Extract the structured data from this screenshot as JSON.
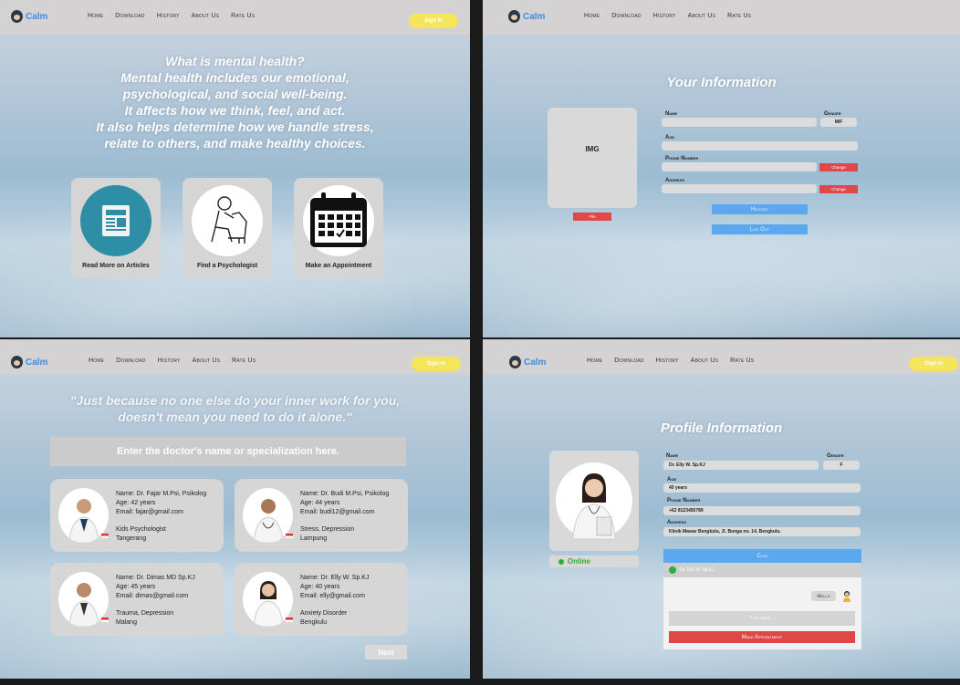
{
  "nav": {
    "brand": "Calm",
    "links": [
      "Home",
      "Download",
      "History",
      "About Us",
      "Rate Us"
    ],
    "signin": "Sign In"
  },
  "home": {
    "hero_lines": [
      "What is mental health?",
      "Mental health includes our emotional,",
      "psychological, and social well-being.",
      "It affects how we think, feel, and act.",
      "It also helps determine how we handle stress,",
      "relate to others, and make healthy choices."
    ],
    "cards": [
      {
        "label": "Read More on Articles",
        "icon": "article-icon"
      },
      {
        "label": "Find a Psychologist",
        "icon": "psychologist-icon"
      },
      {
        "label": "Make an Appointment",
        "icon": "calendar-icon"
      }
    ]
  },
  "user_info": {
    "title": "Your Information",
    "img_placeholder": "IMG",
    "img_button": "File",
    "labels": {
      "name": "Name",
      "gender": "Gender",
      "age": "Age",
      "phone": "Phone Number",
      "address": "Address"
    },
    "gender_value": "M/F",
    "change_label": "Change",
    "history_button": "History",
    "logout_button": "Log Out"
  },
  "search": {
    "quote_lines": [
      "\"Just because no one else do your inner work for you,",
      "doesn't mean you need to do it alone.\""
    ],
    "placeholder": "Enter the doctor's name or specialization here.",
    "doctors": [
      {
        "name": "Name: Dr. Fajar M.Psi, Psikolog",
        "age": "Age: 42 years",
        "email": "Email: fajar@gmail.com",
        "specialty": "Kids Psychologist",
        "city": "Tangerang"
      },
      {
        "name": "Name: Dr. Budi M.Psi, Psikolog",
        "age": "Age: 44 years",
        "email": "Email: budi12@gmail.com",
        "specialty": "Stress, Depression",
        "city": "Lampung"
      },
      {
        "name": "Name: Dr. Dimas MD Sp.KJ",
        "age": "Age: 45 years",
        "email": "Email: dimas@gmail.com",
        "specialty": "Trauma, Depression",
        "city": "Malang"
      },
      {
        "name": "Name: Dr. Elly W. Sp.KJ",
        "age": "Age: 40 years",
        "email": "Email: elly@gmail.com",
        "specialty": "Anxiety Disorder",
        "city": "Bengkulu"
      }
    ],
    "next_button": "Next"
  },
  "profile": {
    "title": "Profile Information",
    "status": "Online",
    "labels": {
      "name": "Name",
      "gender": "Gender",
      "age": "Age",
      "phone": "Phone Number",
      "address": "Address"
    },
    "name": "Dr. Elly W. Sp.KJ",
    "gender": "F",
    "age": "40 years",
    "phone": "+62 8123456789",
    "address": "Klinik Mawar Bengkulu, Jl. Bunga no. 14, Bengkulu.",
    "chat_title": "Chat",
    "chat_contact": "Dr. Elly W. Sp.KJ",
    "chat_message": "Hello",
    "chat_placeholder": "Type here...",
    "appointment_button": "Make Appointment"
  }
}
